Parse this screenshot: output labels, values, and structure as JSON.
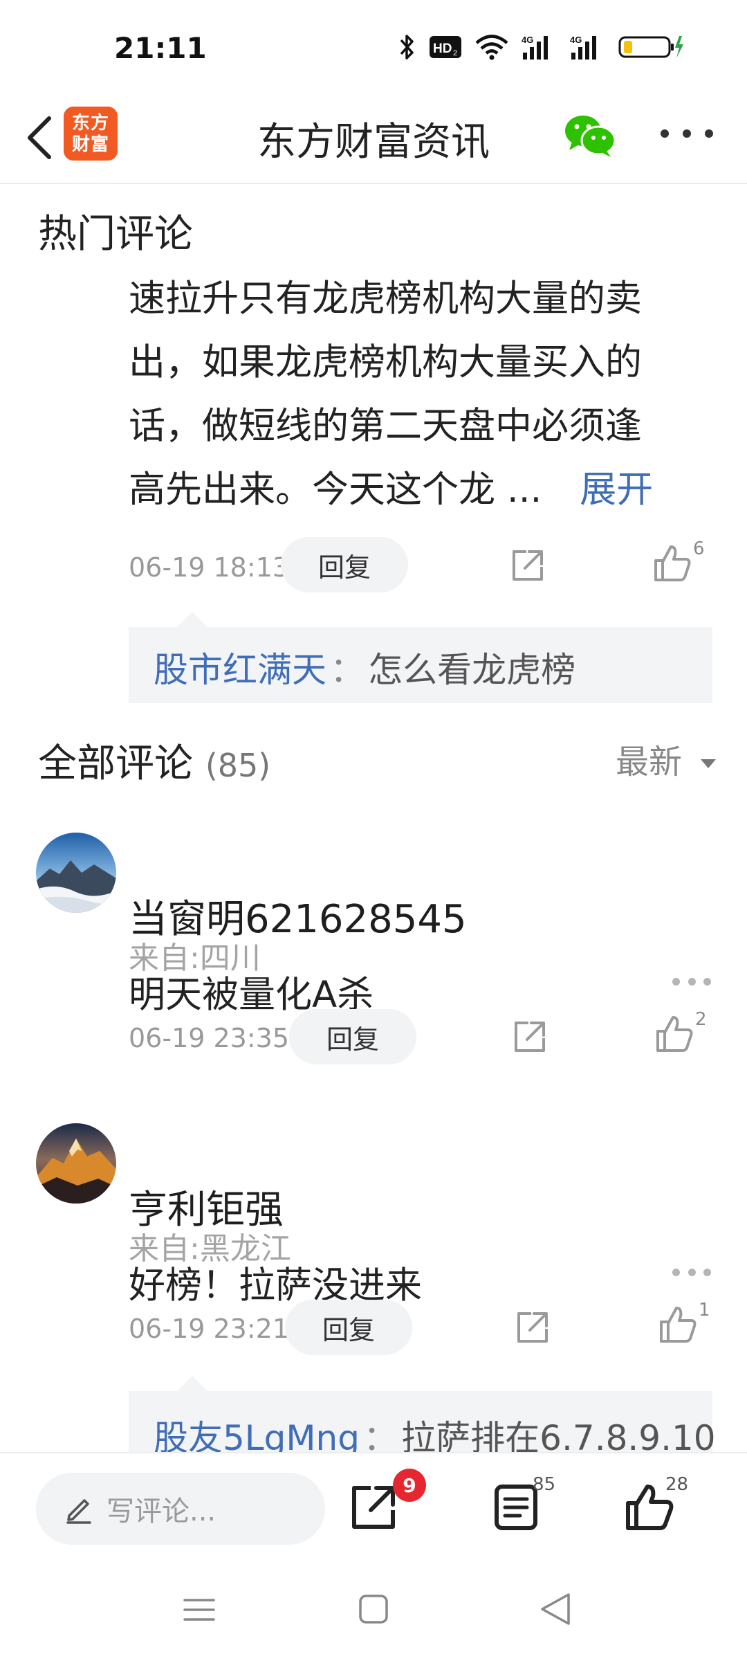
{
  "status_bar": {
    "time": "21:11"
  },
  "header": {
    "logo_text_line1": "东方",
    "logo_text_line2": "财富",
    "title": "东方财富资讯"
  },
  "hot_section": {
    "title": "热门评论",
    "comment": {
      "lines": [
        "速拉升只有龙虎榜机构大量的卖",
        "出，如果龙虎榜机构大量买入的",
        "话，做短线的第二天盘中必须逢",
        "高先出来。今天这个龙 ..."
      ],
      "expand_label": "展开",
      "time": "06-19 18:13",
      "reply_label": "回复",
      "likes": "6",
      "reply": {
        "user": "股市红满天",
        "sep": "：",
        "text": "怎么看龙虎榜"
      }
    }
  },
  "all_section": {
    "title": "全部评论",
    "count": "(85)",
    "sort_label": "最新",
    "comments": [
      {
        "username": "当窗明621628545",
        "location": "来自:四川",
        "text": "明天被量化A杀",
        "time": "06-19 23:35",
        "reply_label": "回复",
        "likes": "2"
      },
      {
        "username": "亨利钜强",
        "location": "来自:黑龙江",
        "text": "好榜！拉萨没进来",
        "time": "06-19 23:21",
        "reply_label": "回复",
        "likes": "1",
        "reply": {
          "user": "股友5LgMng",
          "sep": "：",
          "text": "拉萨排在6.7.8.9.10"
        }
      }
    ]
  },
  "bottom_bar": {
    "input_placeholder": "写评论...",
    "share_badge": "9",
    "comments_count": "85",
    "likes_count": "28"
  },
  "colors": {
    "accent_link": "#3f6db7",
    "logo_orange": "#f15a22",
    "badge_red": "#e8262f",
    "wechat_green": "#2dc100"
  }
}
